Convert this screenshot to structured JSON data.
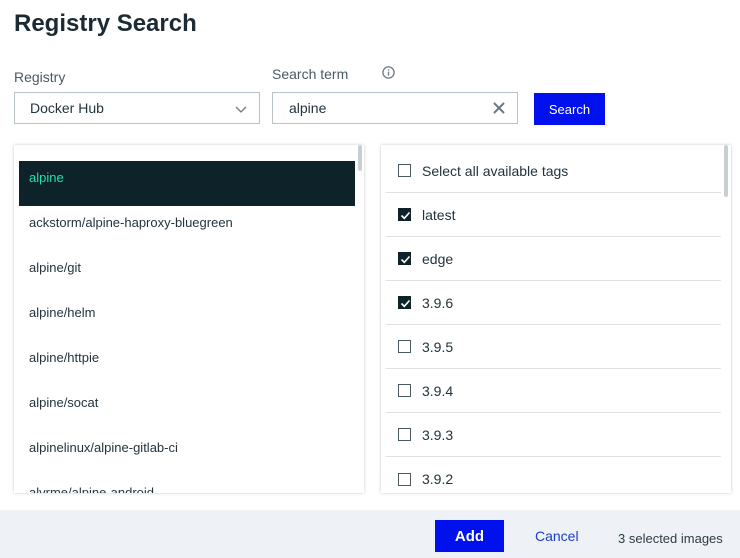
{
  "dialog": {
    "title": "Registry Search"
  },
  "registry": {
    "label": "Registry",
    "selected": "Docker Hub"
  },
  "search": {
    "label": "Search term",
    "value": "alpine",
    "button_label": "Search"
  },
  "repositories": [
    {
      "name": "alpine",
      "active": true
    },
    {
      "name": "ackstorm/alpine-haproxy-bluegreen",
      "active": false
    },
    {
      "name": "alpine/git",
      "active": false
    },
    {
      "name": "alpine/helm",
      "active": false
    },
    {
      "name": "alpine/httpie",
      "active": false
    },
    {
      "name": "alpine/socat",
      "active": false
    },
    {
      "name": "alpinelinux/alpine-gitlab-ci",
      "active": false
    },
    {
      "name": "alvrme/alpine-android",
      "active": false
    }
  ],
  "tags": {
    "select_all_label": "Select all available tags",
    "select_all_checked": false,
    "items": [
      {
        "name": "latest",
        "checked": true
      },
      {
        "name": "edge",
        "checked": true
      },
      {
        "name": "3.9.6",
        "checked": true
      },
      {
        "name": "3.9.5",
        "checked": false
      },
      {
        "name": "3.9.4",
        "checked": false
      },
      {
        "name": "3.9.3",
        "checked": false
      },
      {
        "name": "3.9.2",
        "checked": false
      }
    ]
  },
  "footer": {
    "add_label": "Add",
    "cancel_label": "Cancel",
    "selected_text": "3 selected images"
  },
  "colors": {
    "primary": "#0011ee",
    "active_bg": "#0e2329",
    "active_text": "#1fe0b0",
    "footer_bg": "#eef1f5"
  }
}
